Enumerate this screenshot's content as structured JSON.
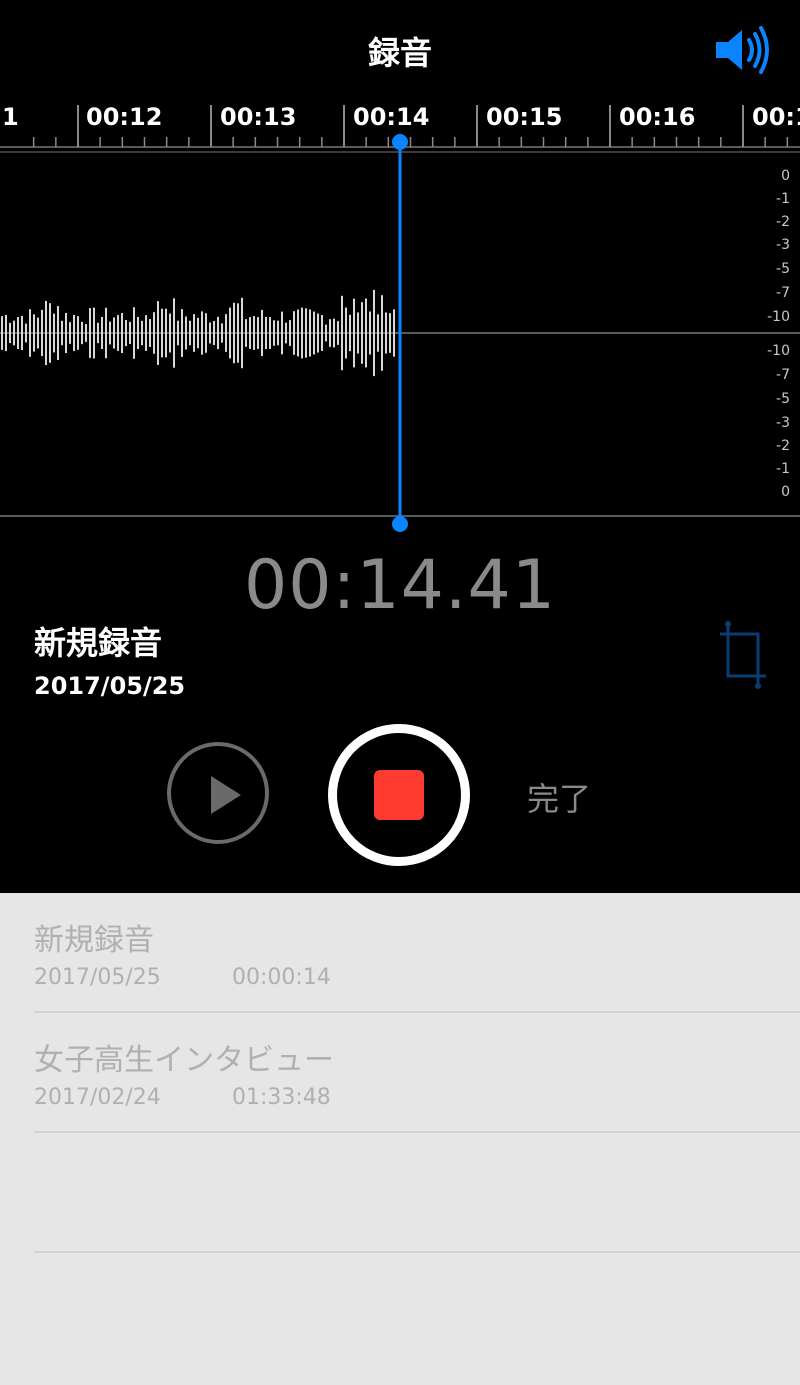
{
  "header": {
    "title": "録音",
    "speaker_icon": "speaker-icon"
  },
  "timeline": {
    "labels": [
      "1",
      "00:12",
      "00:13",
      "00:14",
      "00:15",
      "00:16",
      "00:1"
    ]
  },
  "meter": {
    "upper": [
      "0",
      "-1",
      "-2",
      "-3",
      "-5",
      "-7",
      "-10"
    ],
    "lower": [
      "-10",
      "-7",
      "-5",
      "-3",
      "-2",
      "-1",
      "0"
    ]
  },
  "playhead_color": "#0a84ff",
  "current_time": "00:14.41",
  "recording": {
    "name": "新規録音",
    "date": "2017/05/25"
  },
  "controls": {
    "play_icon": "play-icon",
    "record_icon": "stop-record-icon",
    "done_label": "完了",
    "crop_icon": "crop-icon"
  },
  "list": {
    "items": [
      {
        "title": "新規録音",
        "date": "2017/05/25",
        "duration": "00:00:14"
      },
      {
        "title": "女子高生インタビュー",
        "date": "2017/02/24",
        "duration": "01:33:48"
      }
    ]
  }
}
